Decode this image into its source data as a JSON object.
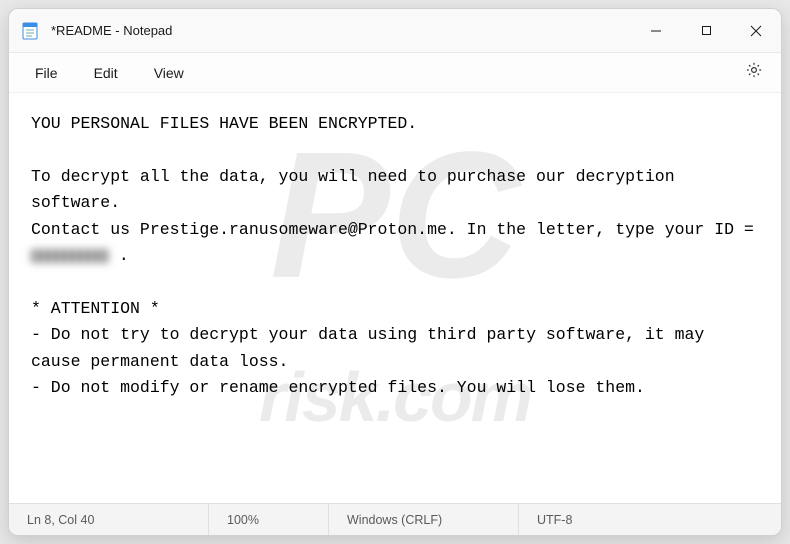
{
  "titlebar": {
    "title": "*README - Notepad"
  },
  "menubar": {
    "file": "File",
    "edit": "Edit",
    "view": "View"
  },
  "document": {
    "line1": "YOU PERSONAL FILES HAVE BEEN ENCRYPTED.",
    "line2a": "To decrypt all the data, you will need to purchase our decryption software.",
    "line2b_pre": "Contact us Prestige.ranusomeware@Proton.me. In the letter, type your ID = ",
    "line2b_post": " .",
    "line3": "* ATTENTION *",
    "line4": "- Do not try to decrypt your data using third party software, it may cause permanent data loss.",
    "line5": "- Do not modify or rename encrypted files. You will lose them."
  },
  "statusbar": {
    "position": "Ln 8, Col 40",
    "zoom": "100%",
    "eol": "Windows (CRLF)",
    "encoding": "UTF-8"
  },
  "watermark": {
    "icon": "PC",
    "text": "risk.com"
  }
}
